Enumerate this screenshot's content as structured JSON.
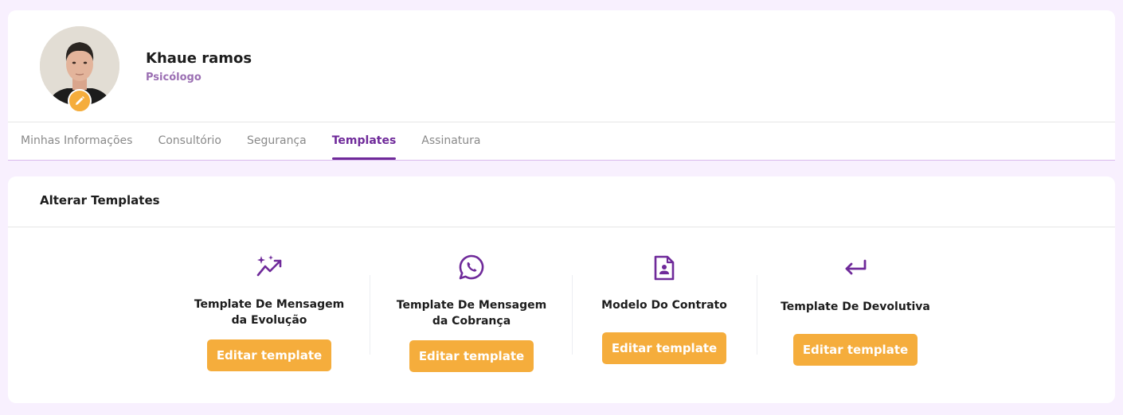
{
  "profile": {
    "name": "Khaue ramos",
    "role": "Psicólogo",
    "edit_icon": "pencil-icon"
  },
  "tabs": [
    {
      "label": "Minhas Informações",
      "active": false
    },
    {
      "label": "Consultório",
      "active": false
    },
    {
      "label": "Segurança",
      "active": false
    },
    {
      "label": "Templates",
      "active": true
    },
    {
      "label": "Assinatura",
      "active": false
    }
  ],
  "section": {
    "title": "Alterar Templates"
  },
  "templates": [
    {
      "icon": "sparkles-chart-icon",
      "title_line1": "Template De Mensagem",
      "title_line2": "da Evolução",
      "button": "Editar template"
    },
    {
      "icon": "whatsapp-icon",
      "title_line1": "Template De Mensagem",
      "title_line2": "da Cobrança",
      "button": "Editar template"
    },
    {
      "icon": "contract-document-icon",
      "title_line1": "Modelo Do Contrato",
      "title_line2": "",
      "button": "Editar template"
    },
    {
      "icon": "return-arrow-icon",
      "title_line1": "Template De Devolutiva",
      "title_line2": "",
      "button": "Editar template"
    }
  ],
  "colors": {
    "accent": "#6f2a9a",
    "button": "#f5ad3c",
    "background": "#f8f0fe"
  }
}
